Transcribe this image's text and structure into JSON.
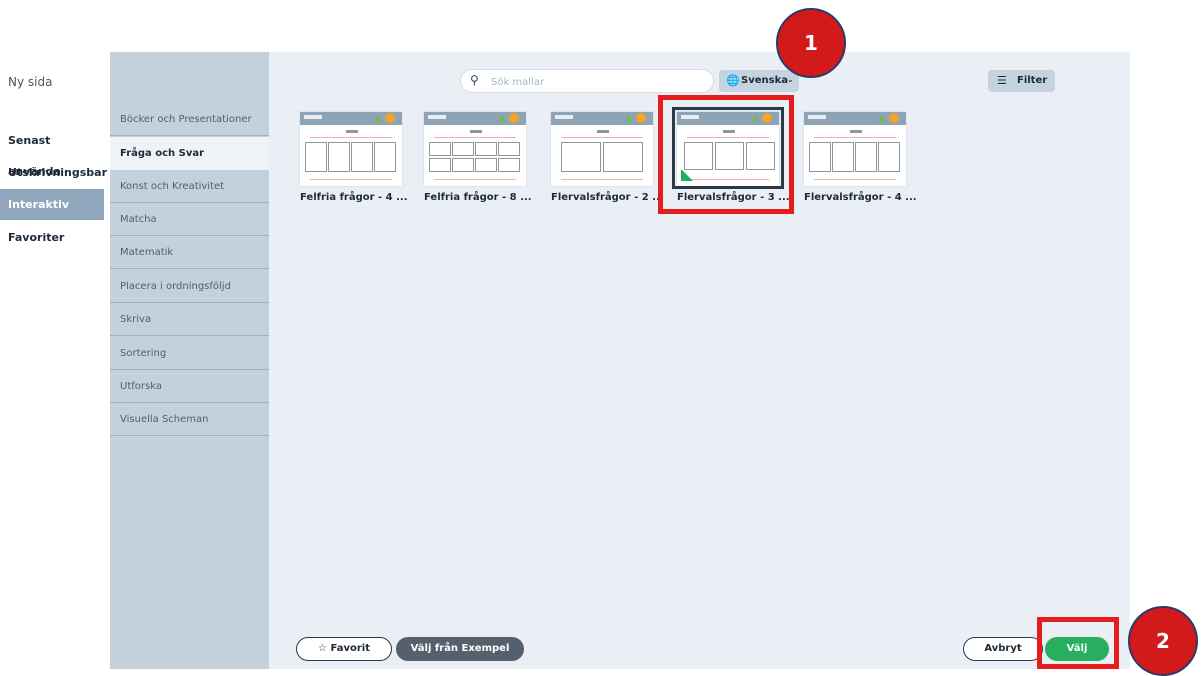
{
  "nav": {
    "new_page": "Ny sida",
    "items": [
      {
        "label": "Senast använda"
      },
      {
        "label": "Utskrivningsbar"
      },
      {
        "label": "Interaktiv"
      },
      {
        "label": "Favoriter"
      }
    ],
    "active_index": 2
  },
  "categories": [
    "Böcker och Presentationer",
    "Fråga och Svar",
    "Konst och Kreativitet",
    "Matcha",
    "Matematik",
    "Placera i ordningsföljd",
    "Skriva",
    "Sortering",
    "Utforska",
    "Visuella Scheman"
  ],
  "selected_category": "Fråga och Svar",
  "toolbar": {
    "search_placeholder": "Sök mallar",
    "language": "Svenska",
    "filter": "Filter"
  },
  "templates": [
    {
      "label": "Felfria frågor - 4 ..."
    },
    {
      "label": "Felfria frågor - 8 ..."
    },
    {
      "label": "Flervalsfrågor - 2 ..."
    },
    {
      "label": "Flervalsfrågor - 3 ..."
    },
    {
      "label": "Flervalsfrågor - 4 ..."
    }
  ],
  "selected_template_index": 3,
  "footer": {
    "favorite": "Favorit",
    "choose_example": "Välj från Exempel",
    "cancel": "Avbryt",
    "choose": "Välj"
  },
  "annotations": {
    "marker1": "1",
    "marker2": "2"
  },
  "colors": {
    "highlight": "#e61b1b",
    "primary": "#27ae5f",
    "nav_active": "#8fa6bd"
  }
}
